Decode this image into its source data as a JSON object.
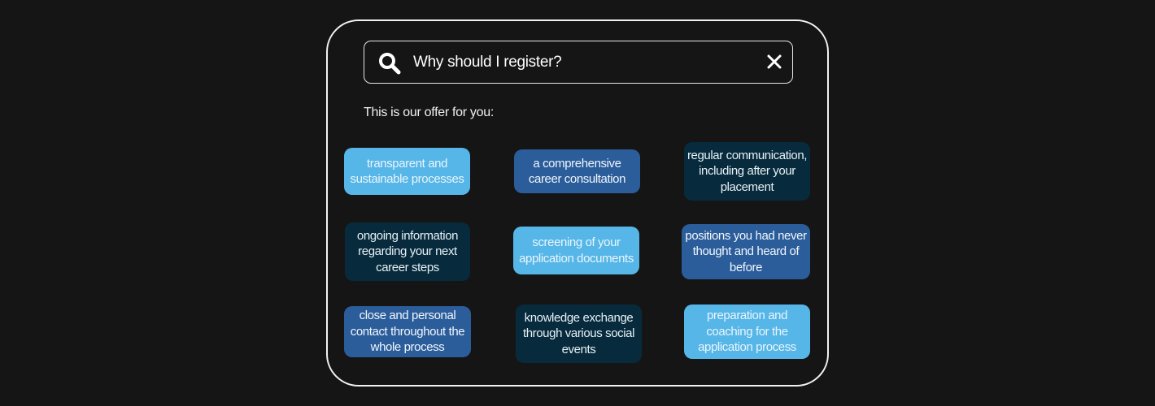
{
  "search": {
    "query": "Why should I register?",
    "search_icon": "search-icon",
    "clear_icon": "close-icon"
  },
  "offer_label": "This is our offer for you:",
  "colors": {
    "background": "#151515",
    "light_blue": "#56b6e8",
    "mid_blue": "#2b5d9b",
    "dark_navy": "#072b3d",
    "border": "#f2f2f2"
  },
  "offers": [
    {
      "text": "transparent and sustainable processes",
      "style": "light"
    },
    {
      "text": "a comprehensive career consultation",
      "style": "mid"
    },
    {
      "text": "regular communication, including after your placement",
      "style": "dark"
    },
    {
      "text": "ongoing information regarding your next career steps",
      "style": "dark"
    },
    {
      "text": "screening of your application documents",
      "style": "light"
    },
    {
      "text": "positions you had never thought and heard of before",
      "style": "mid"
    },
    {
      "text": "close and personal contact throughout the whole process",
      "style": "mid"
    },
    {
      "text": "knowledge exchange through various social events",
      "style": "dark"
    },
    {
      "text": "preparation and coaching for the application process",
      "style": "light"
    }
  ]
}
